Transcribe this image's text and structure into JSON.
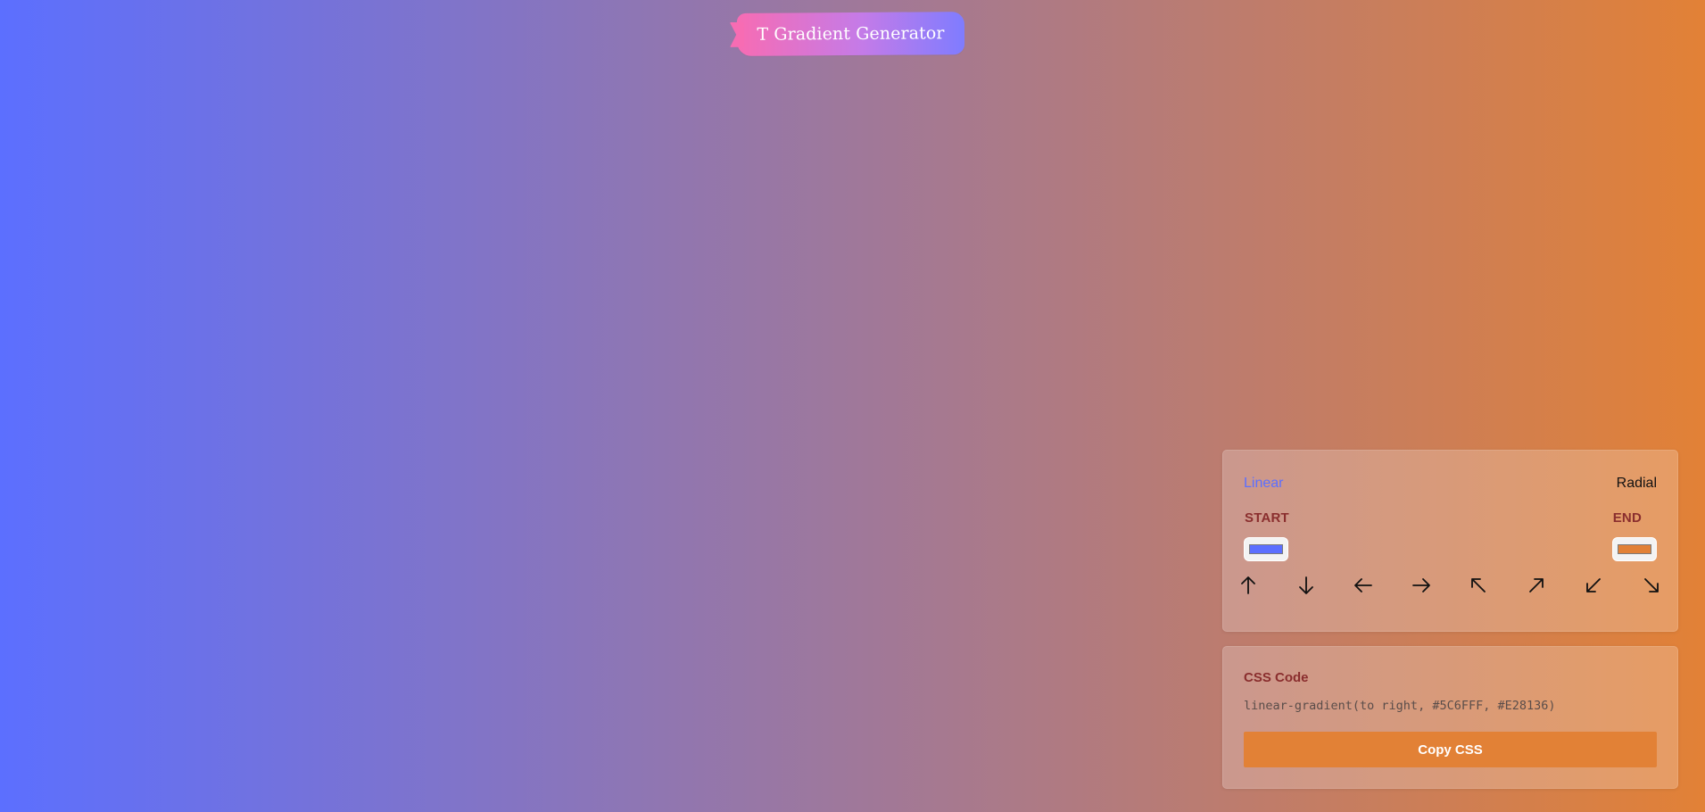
{
  "page": {
    "title": "T Gradient Generator",
    "background_gradient": "linear-gradient(to right, #5C6FFF, #E28136)"
  },
  "colors": {
    "start": "#5C6FFF",
    "end": "#E28136",
    "title_left": "#F76CB3",
    "title_right": "#7F7CFF",
    "label_text": "#8A2E2E",
    "copy_button": "#E28136"
  },
  "controls": {
    "modes": {
      "linear": "Linear",
      "radial": "Radial",
      "selected": "Linear"
    },
    "start_label": "START",
    "end_label": "END",
    "start_color": "#5C6FFF",
    "end_color": "#E28136",
    "directions": [
      {
        "icon": "arrow-up-icon",
        "glyph": "↑",
        "value": "to top"
      },
      {
        "icon": "arrow-down-icon",
        "glyph": "↓",
        "value": "to bottom"
      },
      {
        "icon": "arrow-left-icon",
        "glyph": "←",
        "value": "to left"
      },
      {
        "icon": "arrow-right-icon",
        "glyph": "→",
        "value": "to right"
      },
      {
        "icon": "arrow-up-left-icon",
        "glyph": "↖",
        "value": "to top left"
      },
      {
        "icon": "arrow-up-right-icon",
        "glyph": "↗",
        "value": "to top right"
      },
      {
        "icon": "arrow-down-left-icon",
        "glyph": "↙",
        "value": "to bottom left"
      },
      {
        "icon": "arrow-down-right-icon",
        "glyph": "↘",
        "value": "to bottom right"
      }
    ]
  },
  "code": {
    "heading": "CSS Code",
    "css_text": "linear-gradient(to right, #5C6FFF, #E28136)",
    "copy_label": "Copy CSS"
  }
}
